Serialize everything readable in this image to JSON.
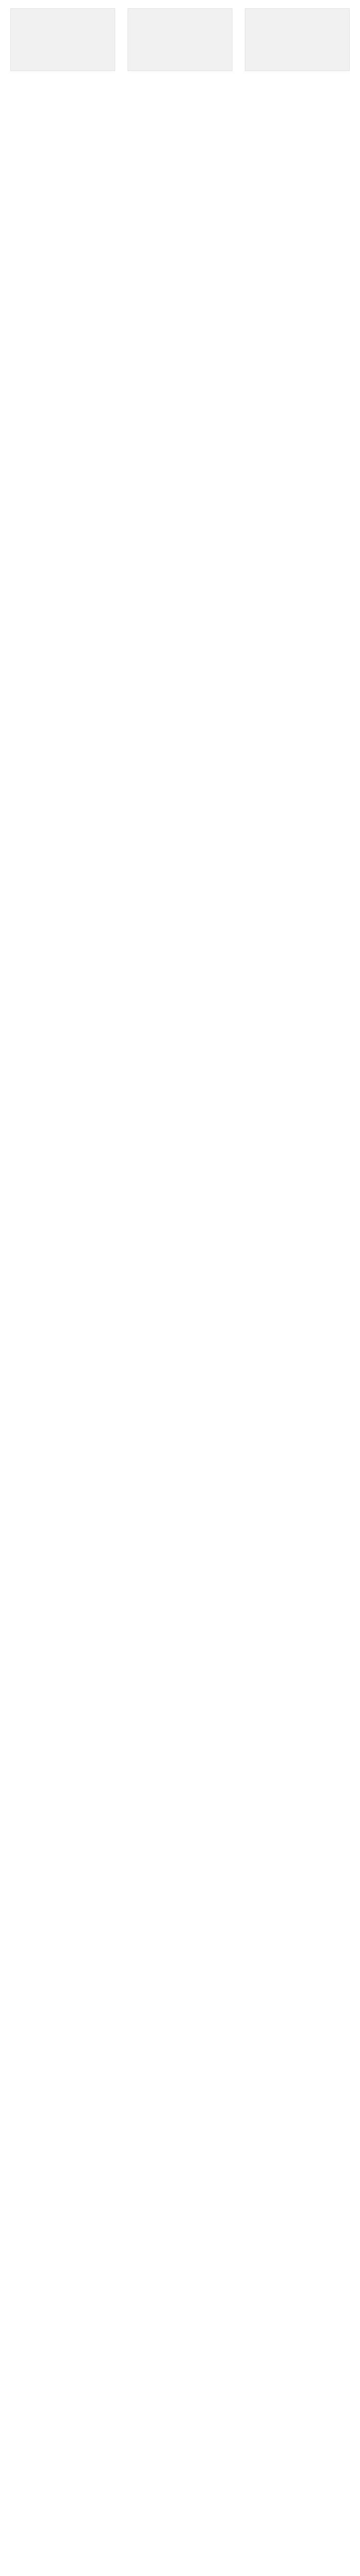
{
  "products": [
    {
      "title": "",
      "price": "",
      "rating": ""
    },
    {
      "title": "",
      "price": "",
      "rating": ""
    },
    {
      "title": "",
      "price": "",
      "rating": ""
    }
  ]
}
